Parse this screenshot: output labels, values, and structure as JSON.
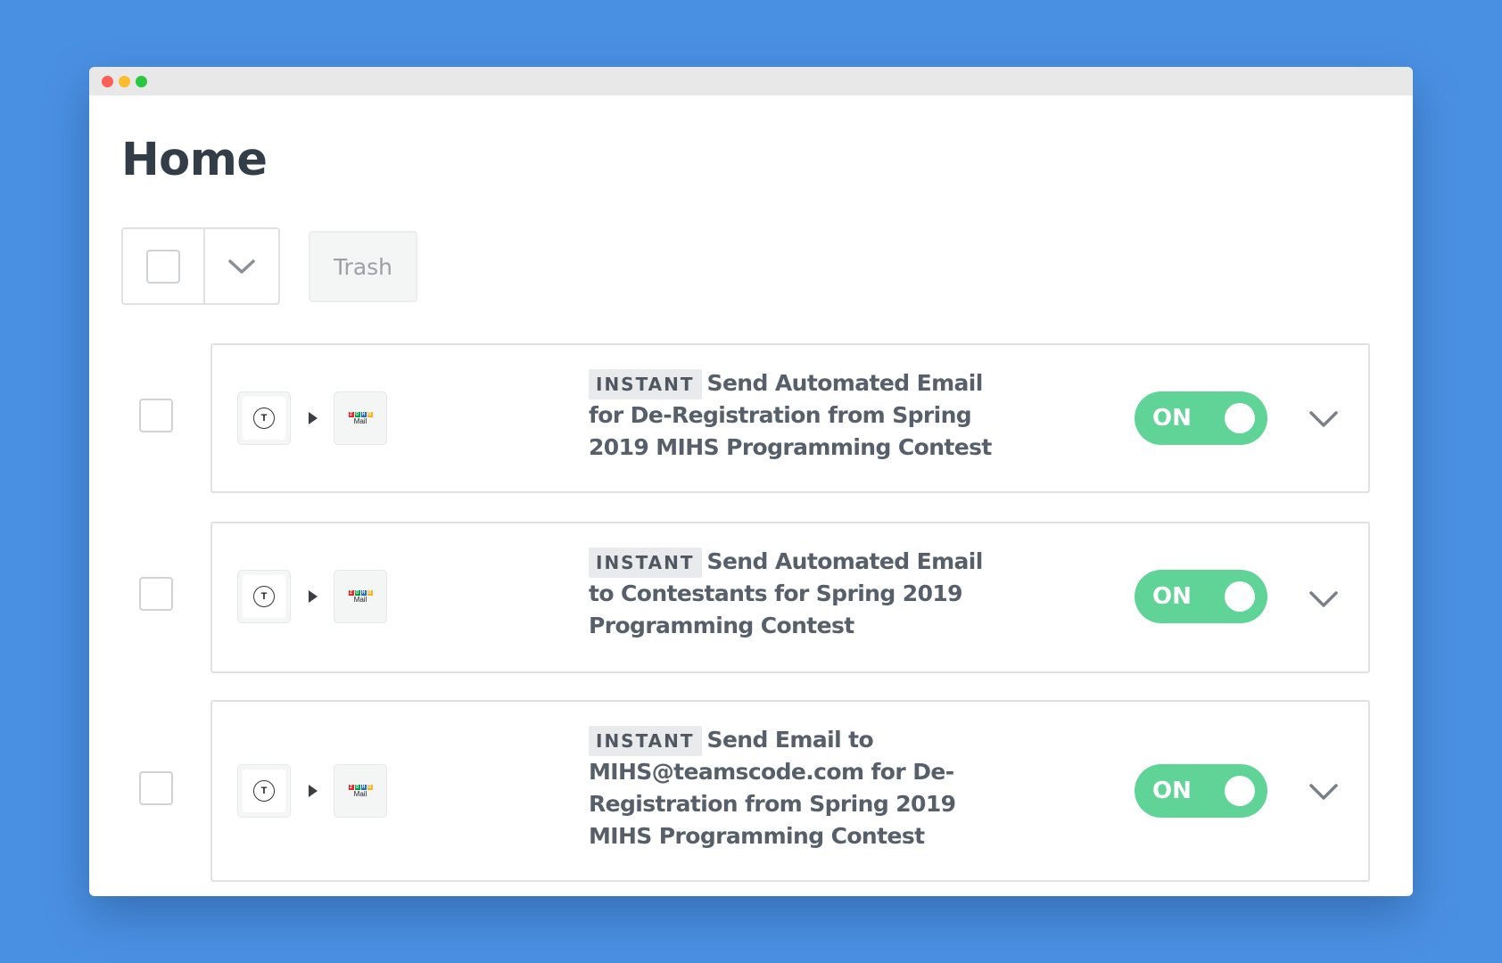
{
  "page": {
    "title": "Home"
  },
  "toolbar": {
    "trash_label": "Trash"
  },
  "zaps": [
    {
      "badge": "INSTANT",
      "name": "Send Automated Email for De-Registration from Spring 2019 MIHS Programming Contest",
      "trigger_app_icon": "t-icon",
      "action_app_icon": "zoho-mail-icon",
      "toggle_label": "ON",
      "enabled": true
    },
    {
      "badge": "INSTANT",
      "name": "Send Automated Email to Contestants for Spring 2019 Programming Contest",
      "trigger_app_icon": "t-icon",
      "action_app_icon": "zoho-mail-icon",
      "toggle_label": "ON",
      "enabled": true
    },
    {
      "badge": "INSTANT",
      "name": "Send Email to MIHS@teamscode.com for De-Registration from Spring 2019 MIHS Programming Contest",
      "trigger_app_icon": "t-icon",
      "action_app_icon": "zoho-mail-icon",
      "toggle_label": "ON",
      "enabled": true
    }
  ],
  "icons": {
    "t_logo_letter": "T",
    "zoho_letters": [
      "Z",
      "O",
      "H",
      "O"
    ],
    "zoho_mail_text": "Mail"
  },
  "colors": {
    "background": "#4a90e2",
    "toggle_on": "#5fd496",
    "title_text": "#333d47"
  }
}
